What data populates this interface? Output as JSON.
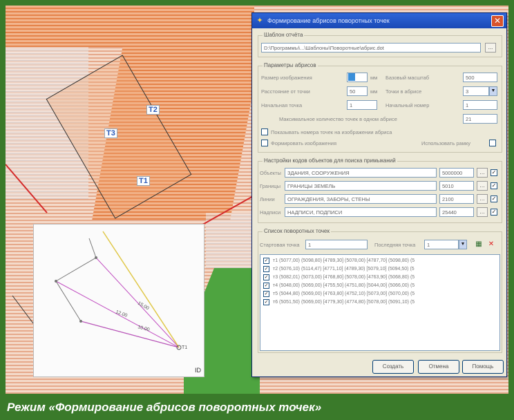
{
  "caption": "Режим «Формирование абрисов поворотных точек»",
  "map": {
    "point_labels": [
      "Т2",
      "Т3",
      "Т1"
    ]
  },
  "inset": {
    "labels": [
      "15.00",
      "12.00",
      "10.00",
      "Т1"
    ],
    "corner_label": "ID"
  },
  "dialog": {
    "title": "Формирование абрисов поворотных точек",
    "close_glyph": "✕",
    "template_group": {
      "title": "Шаблон отчёта",
      "path": "D:\\Программы\\...\\Шаблоны\\Поворотные\\абрис.dot",
      "browse_label": "..."
    },
    "params_group": {
      "title": "Параметры абрисов",
      "rows": [
        {
          "label": "Размер изображения",
          "value": "",
          "unit": "мм",
          "label2": "Базовый масштаб",
          "value2": "500"
        },
        {
          "label": "Расстояние от точки",
          "value": "50",
          "unit": "мм",
          "label2": "Точки в абрисе",
          "value2": "3"
        },
        {
          "label": "Начальная точка",
          "value": "1",
          "label2": "Начальный номер",
          "value2": "1"
        },
        {
          "label": "Максимальное количество точек в одном абрисе",
          "value": "21"
        }
      ],
      "check1": "Показывать номера точек на изображении абриса",
      "check2": "Формировать изображения",
      "check3": "Использовать рамку"
    },
    "codes_group": {
      "title": "Настройки кодов объектов для поиска примыканий",
      "rows": [
        {
          "label": "Объекты",
          "value": "ЗДАНИЯ, СООРУЖЕНИЯ",
          "code": "5000000"
        },
        {
          "label": "Границы",
          "value": "ГРАНИЦЫ ЗЕМЕЛЬ",
          "code": "5010"
        },
        {
          "label": "Линии",
          "value": "ОГРАЖДЕНИЯ, ЗАБОРЫ, СТЕНЫ",
          "code": "2100"
        },
        {
          "label": "Надписи",
          "value": "НАДПИСИ, ПОДПИСИ",
          "code": "25440"
        }
      ]
    },
    "points_group": {
      "title": "Список поворотных точек",
      "start_label": "Стартовая точка",
      "start_value": "1",
      "end_label": "Последняя точка",
      "end_value": "1",
      "rows": [
        "т1 (5077,00) (5098,80) [4789,30] (5078,00) [4787,70] (5098,80) (5",
        "т2 (5076,10) (5114,47) [4771,10] (4789,30) [5079,10] (5094,50) (5",
        "т3 (5082,01) (5073,00) [4768,80] (5078,00) [4763,90] (5068,80) (5",
        "т4 (5048,00) (5069,00) [4755,50] (4751,80) [5044,00] (5066,00) (5",
        "т5 (5044,80) (5069,00) [4763,80] (4752,10) [5073,00] (5070,00) (5",
        "т6 (5051,50) (5069,00) [4779,30] (4774,80) [5078,00] (5091,10) (5"
      ]
    },
    "buttons": {
      "create": "Создать",
      "cancel": "Отмена",
      "help": "Помощь"
    }
  }
}
